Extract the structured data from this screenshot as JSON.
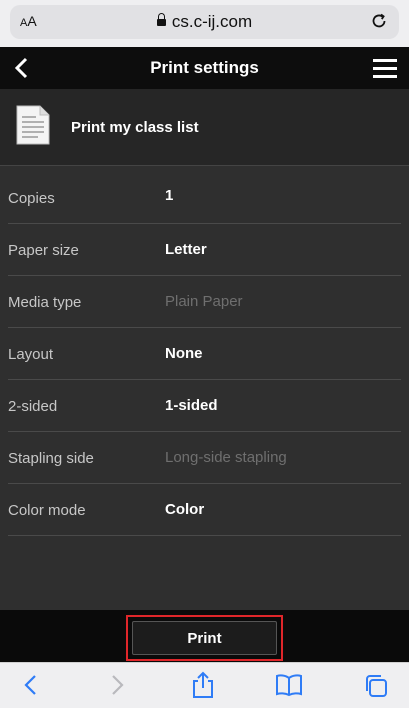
{
  "browser": {
    "aa_label_small": "A",
    "aa_label_large": "A",
    "url": "cs.c-ij.com"
  },
  "header": {
    "title": "Print settings"
  },
  "document": {
    "title": "Print my class list"
  },
  "settings": [
    {
      "label": "Copies",
      "value": "1",
      "enabled": true
    },
    {
      "label": "Paper size",
      "value": "Letter",
      "enabled": true
    },
    {
      "label": "Media type",
      "value": "Plain Paper",
      "enabled": false
    },
    {
      "label": "Layout",
      "value": "None",
      "enabled": true
    },
    {
      "label": "2-sided",
      "value": "1-sided",
      "enabled": true
    },
    {
      "label": "Stapling side",
      "value": "Long-side stapling",
      "enabled": false
    },
    {
      "label": "Color mode",
      "value": "Color",
      "enabled": true
    }
  ],
  "actions": {
    "print_label": "Print"
  },
  "colors": {
    "highlight": "#e0262a",
    "safari_blue": "#2f7cf6"
  }
}
